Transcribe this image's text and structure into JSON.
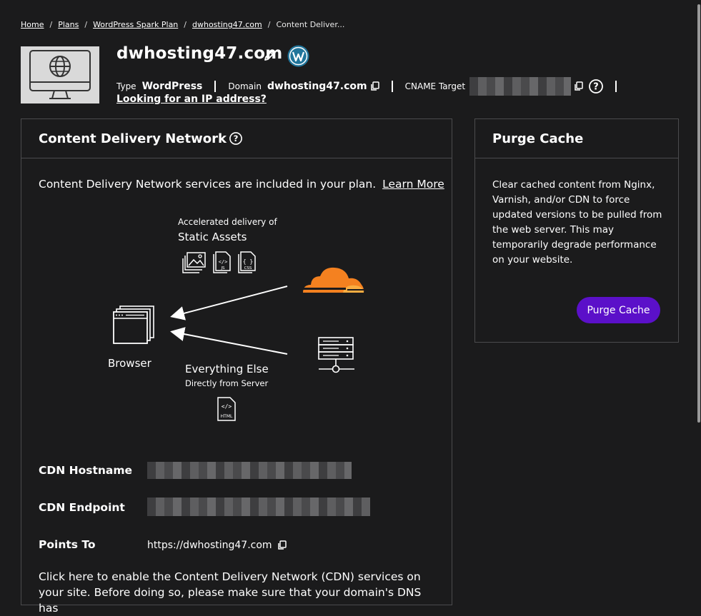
{
  "breadcrumb": {
    "items": [
      "Home",
      "Plans",
      "WordPress Spark Plan",
      "dwhosting47.com"
    ],
    "current": "Content Deliver...",
    "separator": "/"
  },
  "site": {
    "title": "dwhosting47.com",
    "type_label": "Type",
    "type_value": "WordPress",
    "domain_label": "Domain",
    "domain_value": "dwhosting47.com",
    "cname_label": "CNAME Target",
    "ip_link": "Looking for an IP address?"
  },
  "cdn": {
    "title": "Content Delivery Network",
    "intro": "Content Delivery Network services are included in your plan.",
    "learn_more": "Learn More",
    "diagram": {
      "accelerated": "Accelerated delivery of",
      "static_assets": "Static Assets",
      "browser": "Browser",
      "everything_else": "Everything Else",
      "directly": "Directly from Server",
      "js": "JS",
      "css": "CSS",
      "html": "HTML"
    },
    "hostname_label": "CDN Hostname",
    "endpoint_label": "CDN Endpoint",
    "points_to_label": "Points To",
    "points_to_value": "https://dwhosting47.com",
    "enable_text": "Click here to enable the Content Delivery Network (CDN) services on your site. Before doing so, please make sure that your domain's DNS has"
  },
  "purge": {
    "title": "Purge Cache",
    "description": "Clear cached content from Nginx, Varnish, and/or CDN to force updated versions to be pulled from the web server. This may temporarily degrade performance on your website.",
    "button": "Purge Cache"
  },
  "colors": {
    "background": "#1b1b1c",
    "accent": "#5b10c9",
    "cloudflare_orange": "#f48120",
    "wordpress_blue": "#21759b"
  }
}
